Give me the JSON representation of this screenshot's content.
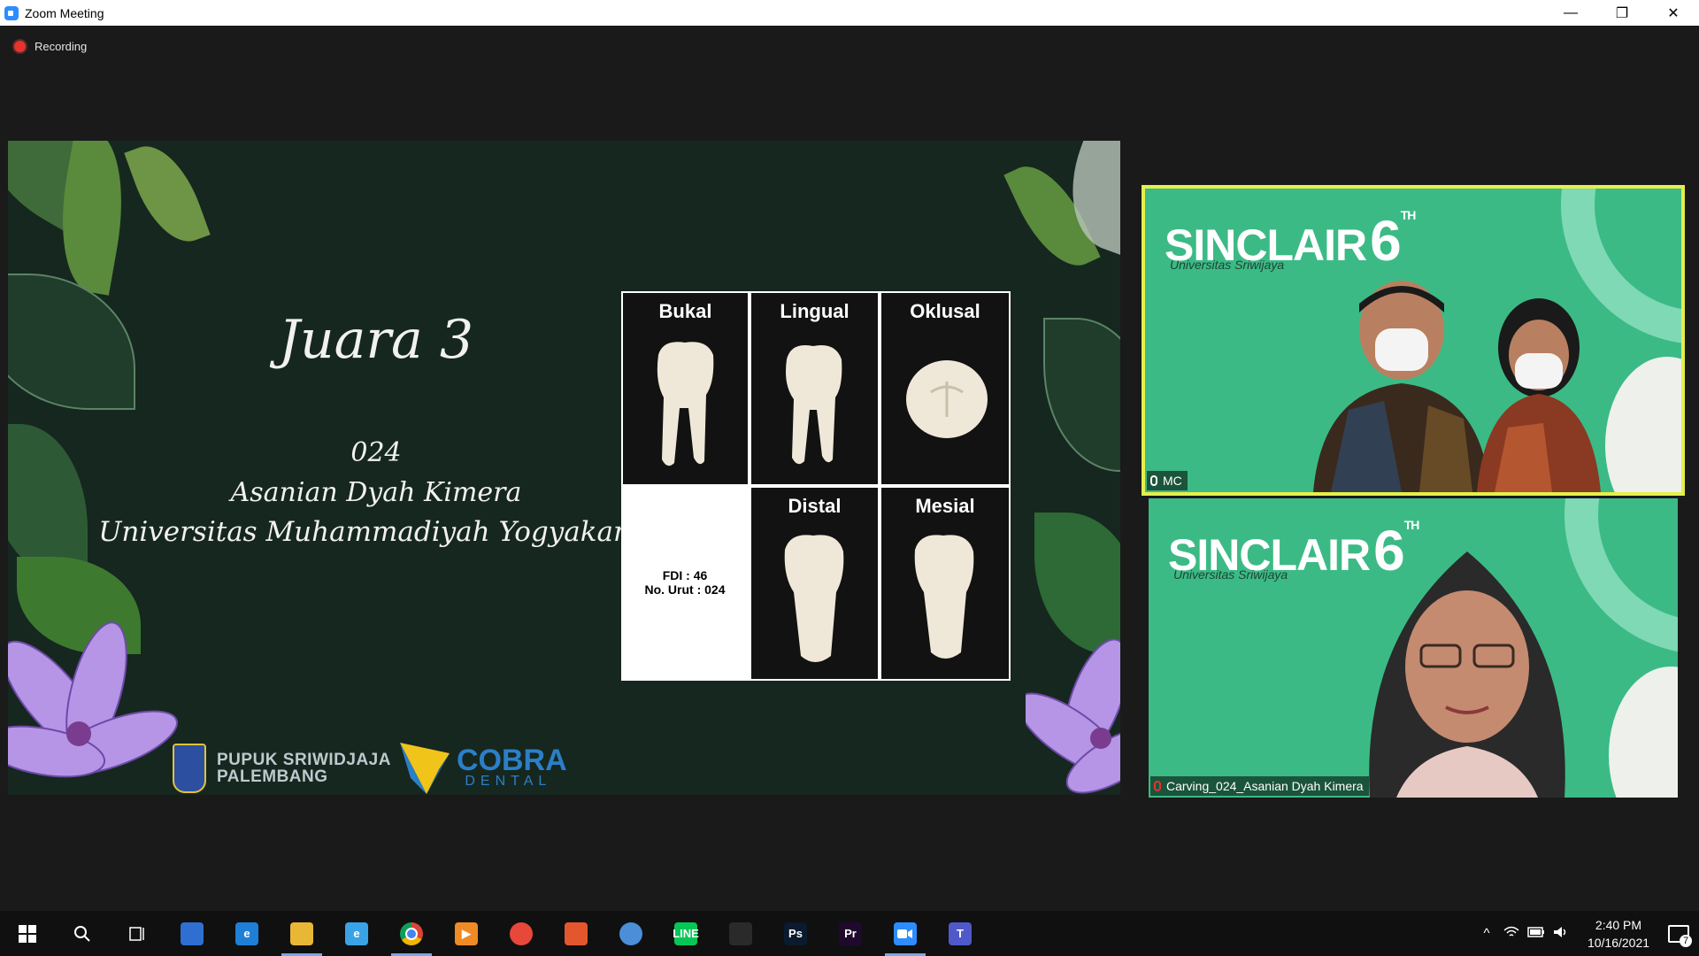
{
  "window": {
    "title": "Zoom Meeting",
    "app_icon": "zoom-icon"
  },
  "window_controls": {
    "minimize": "—",
    "restore": "❐",
    "close": "✕"
  },
  "recording": {
    "label": "Recording",
    "dot_color": "#e5332e"
  },
  "shared_screen": {
    "heading": "Juara 3",
    "number": "024",
    "name": "Asanian Dyah Kimera",
    "university": "Universitas Muhammadiyah Yogyakarta",
    "views": [
      "Bukal",
      "Lingual",
      "Oklusal",
      "Distal",
      "Mesial"
    ],
    "fdi": "FDI : 46",
    "urut": "No. Urut : 024",
    "sponsor1": {
      "line1": "PUPUK SRIWIDJAJA",
      "line2": "PALEMBANG"
    },
    "sponsor2": {
      "name": "COBRA",
      "sub": "DENTAL"
    }
  },
  "participants": [
    {
      "name": "MC",
      "muted": false,
      "brand": "SINCLAIR",
      "brand_num": "6",
      "brand_sup": "TH",
      "brand_sub": "Universitas Sriwijaya",
      "active_speaker": true
    },
    {
      "name": "Carving_024_Asanian Dyah Kimera",
      "muted": true,
      "brand": "SINCLAIR",
      "brand_num": "6",
      "brand_sup": "TH",
      "brand_sub": "Universitas Sriwijaya",
      "active_speaker": false
    }
  ],
  "taskbar": {
    "apps": [
      {
        "icon": "windows-start-icon",
        "color": "transparent",
        "text": ""
      },
      {
        "icon": "search-icon",
        "color": "transparent",
        "text": ""
      },
      {
        "icon": "task-view-icon",
        "color": "transparent",
        "text": ""
      },
      {
        "icon": "microsoft-store-icon",
        "color": "#2f6fd1",
        "text": ""
      },
      {
        "icon": "edge-legacy-icon",
        "color": "#1f7fd6",
        "text": "e"
      },
      {
        "icon": "file-explorer-icon",
        "color": "#e9b736",
        "text": ""
      },
      {
        "icon": "internet-explorer-icon",
        "color": "#3aa3e8",
        "text": "e"
      },
      {
        "icon": "chrome-icon",
        "color": "#db4437",
        "text": ""
      },
      {
        "icon": "media-player-icon",
        "color": "#f08a24",
        "text": "▶"
      },
      {
        "icon": "camera-app-icon",
        "color": "#e8483a",
        "text": ""
      },
      {
        "icon": "autodesk-icon",
        "color": "#e4572e",
        "text": ""
      },
      {
        "icon": "globe-app-icon",
        "color": "#4a8fd8",
        "text": ""
      },
      {
        "icon": "line-icon",
        "color": "#06c755",
        "text": "LINE"
      },
      {
        "icon": "xodo-icon",
        "color": "#2a2a2a",
        "text": ""
      },
      {
        "icon": "photoshop-icon",
        "color": "#0b1a2e",
        "text": "Ps"
      },
      {
        "icon": "premiere-icon",
        "color": "#1f0a2e",
        "text": "Pr"
      },
      {
        "icon": "zoom-icon",
        "color": "#2d8cff",
        "text": ""
      },
      {
        "icon": "teams-icon",
        "color": "#5059c9",
        "text": "T"
      }
    ],
    "active_app": "zoom-icon",
    "tray": {
      "chevron": "^",
      "wifi": "wifi-icon",
      "battery": "battery-icon",
      "volume": "volume-icon"
    },
    "time": "2:40 PM",
    "date": "10/16/2021",
    "notifications": "7"
  }
}
